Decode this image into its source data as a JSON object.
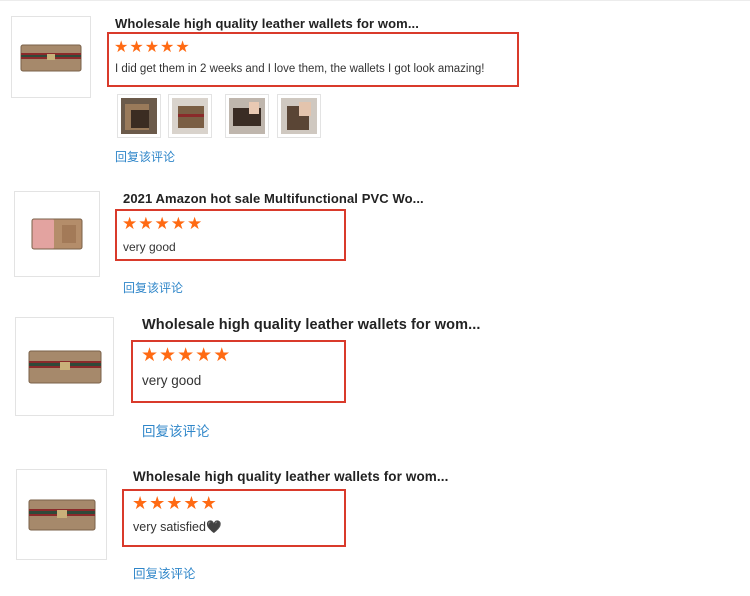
{
  "reviews": [
    {
      "product_title": "Wholesale high quality leather wallets for wom...",
      "rating": 5,
      "text": "I did get them in 2 weeks and I love them, the wallets I got look amazing!",
      "reply_label": "回复该评论",
      "photo_count": 4
    },
    {
      "product_title": "2021 Amazon hot sale Multifunctional PVC Wo...",
      "rating": 5,
      "text": "very good",
      "reply_label": "回复该评论"
    },
    {
      "product_title": "Wholesale high quality leather wallets for wom...",
      "rating": 5,
      "text": "very good",
      "reply_label": "回复该评论"
    },
    {
      "product_title": "Wholesale high quality leather wallets for wom...",
      "rating": 5,
      "text": "very satisfied🖤",
      "reply_label": "回复该评论"
    }
  ],
  "colors": {
    "star": "#ff6a13",
    "highlight_border": "#d93a2b",
    "reply_link": "#2f86c9"
  }
}
